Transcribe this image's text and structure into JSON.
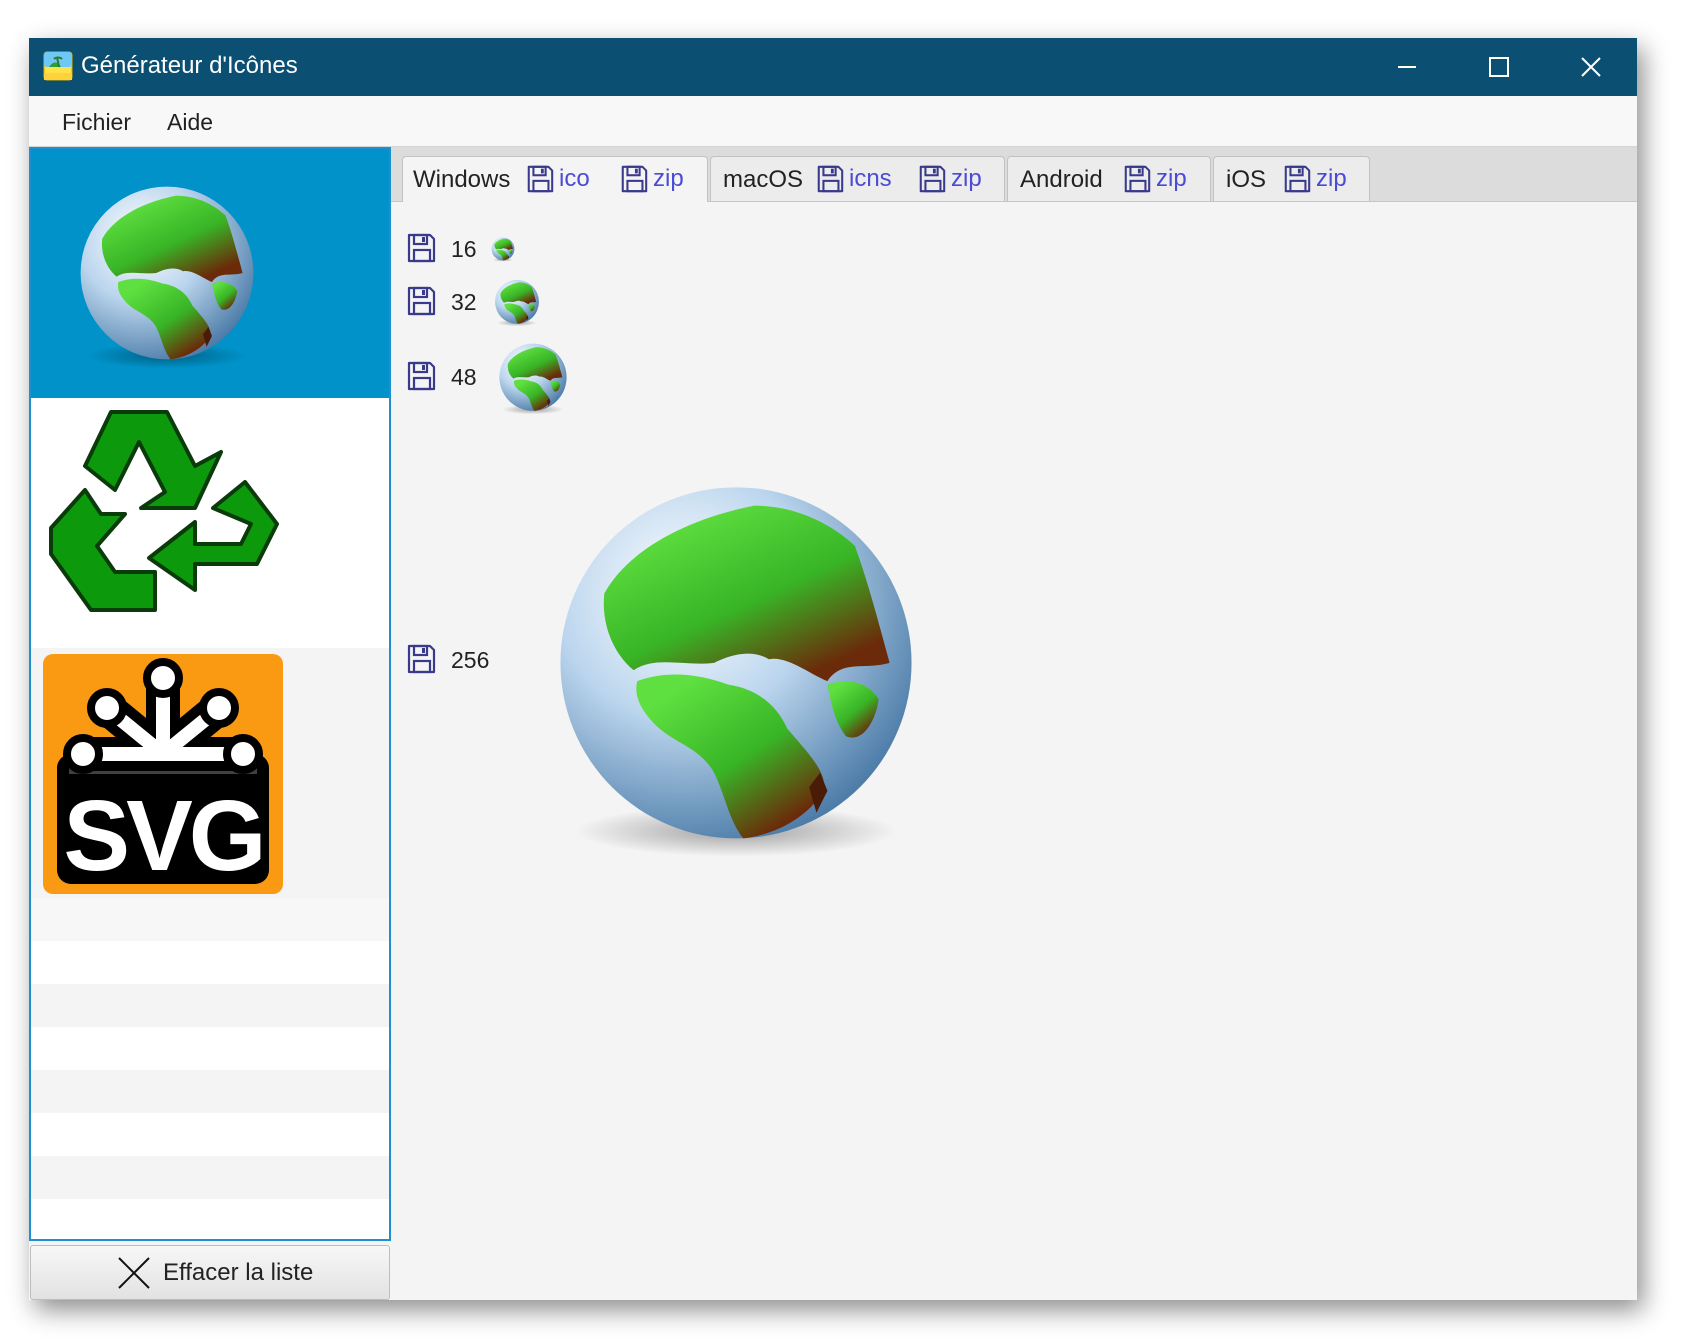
{
  "window": {
    "title": "Générateur d'Icônes",
    "controls": [
      "minimize",
      "maximize",
      "close"
    ]
  },
  "menu": {
    "items": [
      {
        "label": "Fichier"
      },
      {
        "label": "Aide"
      }
    ]
  },
  "file_list": {
    "selected_index": 0,
    "items": [
      {
        "icon": "globe-icon"
      },
      {
        "icon": "recycle-icon"
      },
      {
        "icon": "svg-logo-icon"
      }
    ],
    "clear_button": {
      "label": "Effacer la liste",
      "icon": "x-icon"
    }
  },
  "tabs": [
    {
      "label": "Windows",
      "active": true,
      "saves": [
        {
          "label": "ico"
        },
        {
          "label": "zip"
        }
      ]
    },
    {
      "label": "macOS",
      "active": false,
      "saves": [
        {
          "label": "icns"
        },
        {
          "label": "zip"
        }
      ]
    },
    {
      "label": "Android",
      "active": false,
      "saves": [
        {
          "label": "zip"
        }
      ]
    },
    {
      "label": "iOS",
      "active": false,
      "saves": [
        {
          "label": "zip"
        }
      ]
    }
  ],
  "sizes": [
    {
      "label": "16"
    },
    {
      "label": "32"
    },
    {
      "label": "48"
    },
    {
      "label": "256"
    }
  ],
  "colors": {
    "titlebar": "#0b4f72",
    "selection": "#0092c9",
    "save_link": "#4b4bd6",
    "recycle_green": "#0c9a0c",
    "svg_orange": "#f99a12"
  }
}
